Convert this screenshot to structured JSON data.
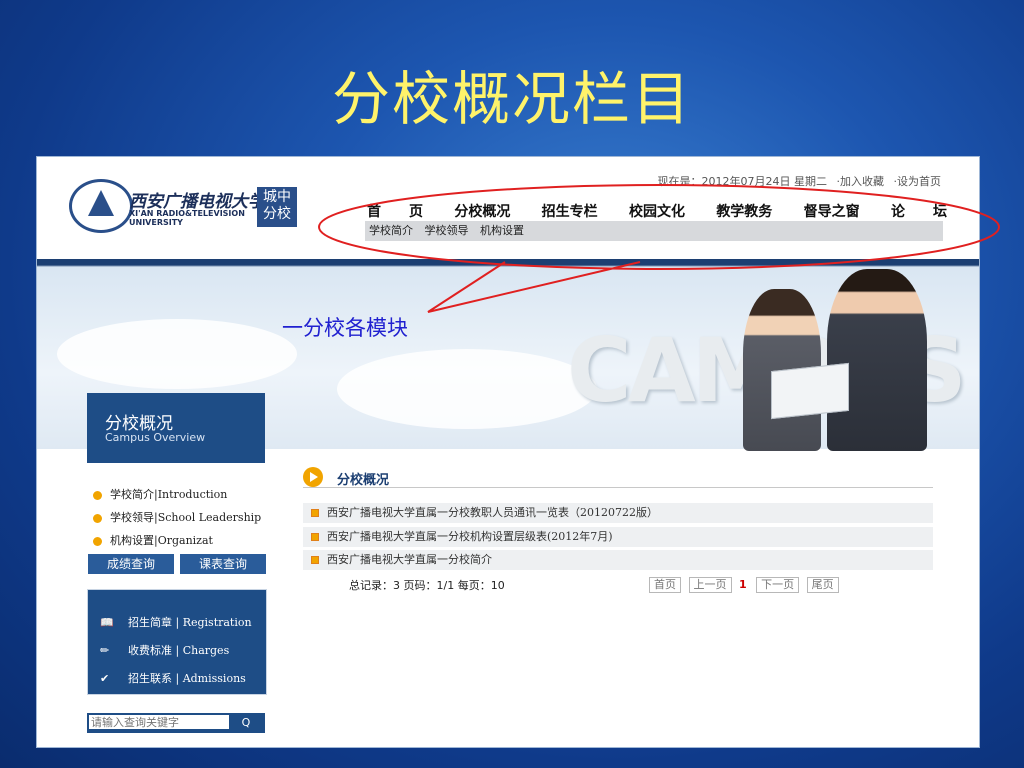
{
  "slide": {
    "title": "分校概况栏目",
    "annotation": "一分校各模块"
  },
  "header": {
    "logo_cn": "西安广播电视大学",
    "logo_en_1": "XI'AN RADIO&TELEVISION",
    "logo_en_2": "UNIVERSITY",
    "campus_1": "城中",
    "campus_2": "分校",
    "date": "现在是：2012年07月24日 星期二",
    "bookmark": "·加入收藏",
    "homepage": "·设为首页"
  },
  "nav": [
    "首　　页",
    "分校概况",
    "招生专栏",
    "校园文化",
    "教学教务",
    "督导之窗",
    "论　　坛"
  ],
  "subnav": [
    "学校简介",
    "学校领导",
    "机构设置"
  ],
  "banner": {
    "campus_word": "CAMPUS"
  },
  "sidebar": {
    "title": "分校概况",
    "subtitle": "Campus Overview",
    "items": [
      "学校简介|Introduction",
      "学校领导|School Leadership",
      "机构设置|Organizat"
    ],
    "buttons": [
      "成绩查询",
      "课表查询"
    ],
    "links": [
      {
        "label": "招生简章 | Registration",
        "icon": "book-icon"
      },
      {
        "label": "收费标准 | Charges",
        "icon": "pen-icon"
      },
      {
        "label": "招生联系 | Admissions",
        "icon": "check-icon"
      }
    ],
    "search_placeholder": "请输入查询关键字",
    "search_button": "Q"
  },
  "content": {
    "title": "分校概况",
    "rows": [
      "西安广播电视大学直属一分校教职人员通讯一览表（20120722版）",
      "西安广播电视大学直属一分校机构设置层级表(2012年7月)",
      "西安广播电视大学直属一分校简介"
    ],
    "pager_text": "总记录：3 页码：1/1 每页：10",
    "pager": {
      "first": "首页",
      "prev": "上一页",
      "current": "1",
      "next": "下一页",
      "last": "尾页"
    }
  },
  "colors": {
    "title": "#fff36a",
    "annotation": "#2020d0",
    "accent": "#f1a400",
    "ellipse": "#e02020"
  }
}
